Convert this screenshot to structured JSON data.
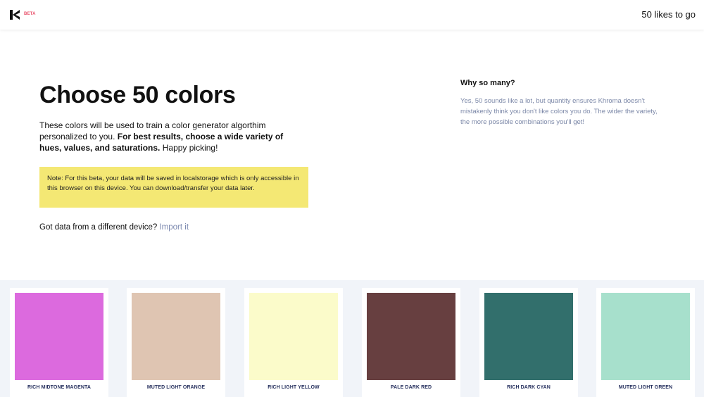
{
  "header": {
    "beta_label": "BETA",
    "likes_text": "50 likes to go"
  },
  "main": {
    "title": "Choose 50 colors",
    "intro_plain": "These colors will be used to train a color generator algorthim personalized to you.",
    "intro_bold": "For best results, choose a wide variety of hues, values, and saturations.",
    "intro_tail": "Happy picking!",
    "note": "Note: For this beta, your data will be saved in localstorage which is only accessible in this browser on this device. You can download/transfer your data later.",
    "import_prompt": "Got data from a different device?",
    "import_link": "Import it"
  },
  "aside": {
    "title": "Why so many?",
    "text": "Yes, 50 sounds like a lot, but quantity ensures Khroma doesn't mistakenly think you don't like colors you do. The wider the variety, the more possible combinations you'll get!"
  },
  "swatches": [
    {
      "label": "RICH MIDTONE MAGENTA",
      "color": "#dc6ade"
    },
    {
      "label": "MUTED LIGHT ORANGE",
      "color": "#dfc5b2"
    },
    {
      "label": "RICH LIGHT YELLOW",
      "color": "#fbfbca"
    },
    {
      "label": "PALE DARK RED",
      "color": "#673f40"
    },
    {
      "label": "RICH DARK CYAN",
      "color": "#326f6c"
    },
    {
      "label": "MUTED LIGHT GREEN",
      "color": "#a7e0cc"
    }
  ],
  "colors": {
    "note_bg": "#f4e874",
    "link": "#7d8ab0",
    "beta": "#e8506a",
    "swatch_area_bg": "#f1f4f9"
  }
}
